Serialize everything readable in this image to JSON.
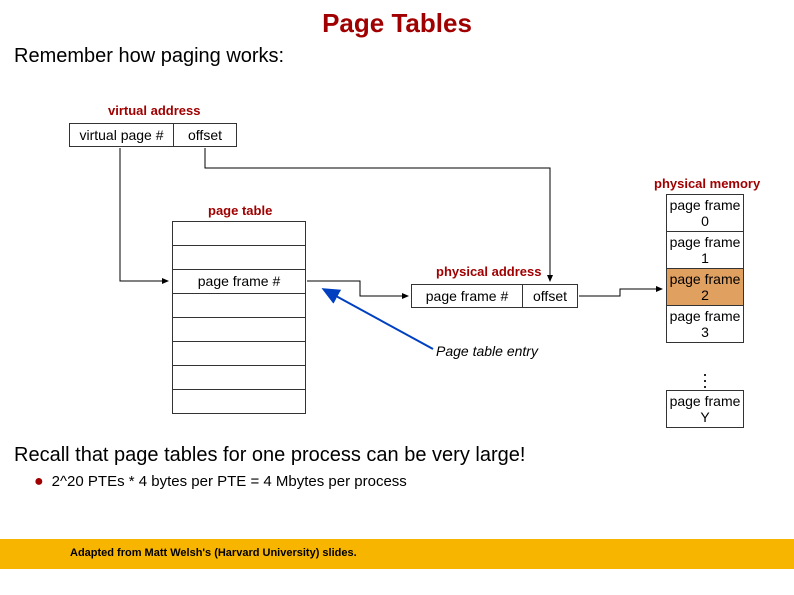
{
  "title": "Page Tables",
  "subtitle": "Remember how paging works:",
  "labels": {
    "virtual_address": "virtual address",
    "virtual_page_num": "virtual page #",
    "offset": "offset",
    "page_table": "page table",
    "page_frame_num_pt": "page frame #",
    "physical_address": "physical address",
    "page_frame_num_pa": "page frame #",
    "offset_pa": "offset",
    "pte": "Page table entry",
    "physical_memory": "physical memory",
    "pm0": "page frame 0",
    "pm1": "page frame 1",
    "pm2": "page frame 2",
    "pm3": "page frame 3",
    "pmY": "page frame Y"
  },
  "recall": "Recall that page tables for one process can be very large!",
  "bullet": "2^20 PTEs * 4 bytes per PTE = 4 Mbytes per process",
  "credit": "Adapted from Matt Welsh's (Harvard University) slides."
}
